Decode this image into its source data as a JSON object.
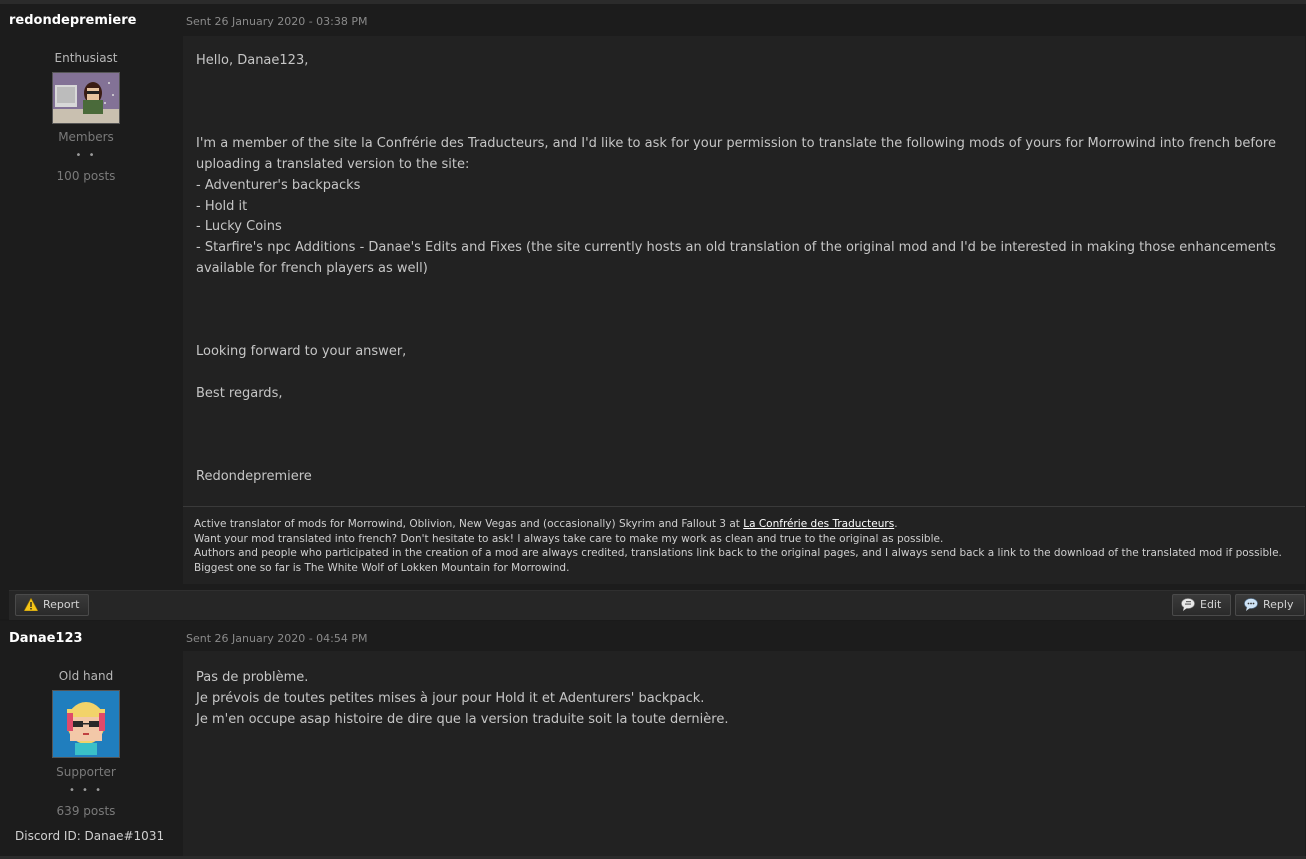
{
  "posts": [
    {
      "username": "redondepremiere",
      "rank": "Enthusiast",
      "group": "Members",
      "group_pips": "• •",
      "post_count": "100 posts",
      "date": "Sent 26 January 2020 - 03:38 PM",
      "body": [
        "Hello, Danae123,",
        "",
        "",
        "",
        "I'm a member of the site la Confrérie des Traducteurs, and I'd like to ask for your permission to translate the following mods of yours for Morrowind into french before uploading a translated version to the site:",
        "- Adventurer's backpacks",
        "- Hold it",
        "- Lucky Coins",
        "- Starfire's npc Additions - Danae's Edits and Fixes (the site currently hosts an old translation of the original mod and I'd be interested in making those enhancements available for french players as well)",
        "",
        "",
        "",
        "Looking forward to your answer,",
        "",
        "Best regards,",
        "",
        "",
        "",
        "Redondepremiere"
      ],
      "signature": {
        "line1_prefix": "Active translator of mods for Morrowind, Oblivion, New Vegas and (occasionally) Skyrim and Fallout 3 at ",
        "line1_link": "La Confrérie des Traducteurs",
        "line1_suffix": ".",
        "line2": "Want your mod translated into french? Don't hesitate to ask! I always take care to make my work as clean and true to the original as possible.",
        "line3": "Authors and people who participated in the creation of a mod are always credited, translations link back to the original pages, and I always send back a link to the download of the translated mod if possible.",
        "line4": "Biggest one so far is The White Wolf of Lokken Mountain for Morrowind."
      },
      "actions": {
        "report": "Report",
        "edit": "Edit",
        "reply": "Reply"
      }
    },
    {
      "username": "Danae123",
      "rank": "Old hand",
      "group": "Supporter",
      "group_pips": "• • •",
      "post_count": "639 posts",
      "discord": "Discord ID: Danae#1031",
      "date": "Sent 26 January 2020 - 04:54 PM",
      "body": [
        "Pas de problème.",
        "Je prévois de toutes petites mises à jour pour Hold it et Adenturers' backpack.",
        "Je m'en occupe asap histoire de dire que la version traduite soit la toute dernière."
      ]
    }
  ],
  "icons": {
    "report": "warning-icon",
    "edit": "speech-bubble-edit-icon",
    "reply": "speech-bubble-icon"
  },
  "colors": {
    "background": "#1a1a1a",
    "content": "#222222",
    "warning": "#f5c518"
  }
}
